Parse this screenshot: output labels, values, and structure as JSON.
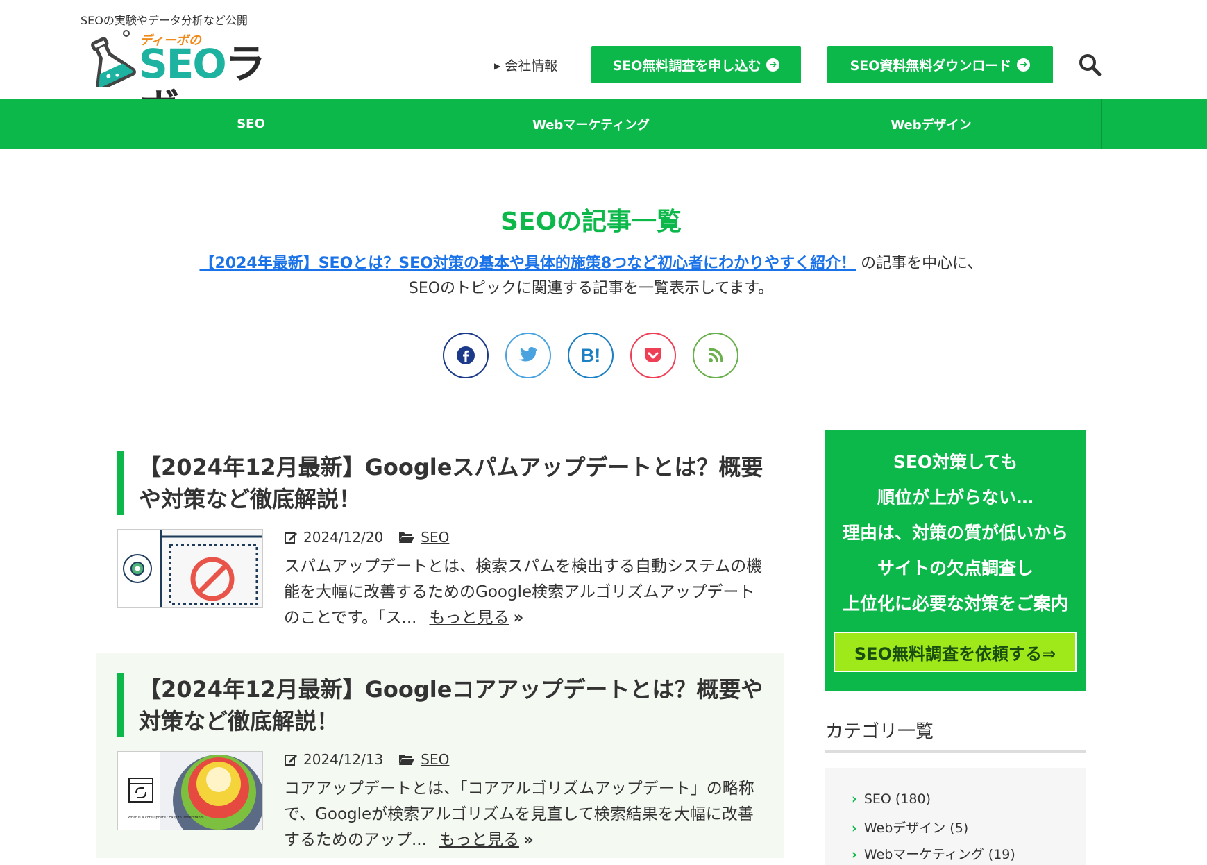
{
  "header": {
    "tagline": "SEOの実験やデータ分析など公開",
    "logo_sub": "ディーボの",
    "logo_seo": "SEO",
    "logo_labo": "ラボ",
    "company_link": "会社情報",
    "btn_survey": "SEO無料調査を申し込む",
    "btn_download": "SEO資料無料ダウンロード"
  },
  "nav": {
    "items": [
      "SEO",
      "Webマーケティング",
      "Webデザイン"
    ]
  },
  "main": {
    "page_title": "SEOの記事一覧",
    "intro_link": "【2024年最新】SEOとは？SEO対策の基本や具体的施策8つなど初心者にわかりやすく紹介！",
    "intro_after": "の記事を中心に、",
    "intro_line2": "SEOのトピックに関連する記事を一覧表示してます。"
  },
  "share": {
    "icons": [
      "facebook-icon",
      "twitter-icon",
      "hatena-bookmark-icon",
      "pocket-icon",
      "rss-icon"
    ],
    "colors": [
      "#1d3a8a",
      "#4aa3df",
      "#1b80c4",
      "#ef3f56",
      "#6ab04c"
    ]
  },
  "articles": [
    {
      "title": "【2024年12月最新】Googleスパムアップデートとは？概要や対策など徹底解説！",
      "date": "2024/12/20",
      "category": "SEO",
      "excerpt": "スパムアップデートとは、検索スパムを検出する自動システムの機能を大幅に改善するためのGoogle検索アルゴリズムアップデートのことです。「ス...",
      "more": "もっと見る"
    },
    {
      "title": "【2024年12月最新】Googleコアアップデートとは？概要や対策など徹底解説！",
      "date": "2024/12/13",
      "category": "SEO",
      "excerpt": "コアアップデートとは、「コアアルゴリズムアップデート」の略称で、Googleが検索アルゴリズムを見直して検索結果を大幅に改善するためのアップ...",
      "more": "もっと見る",
      "thumb_caption": "What is a core update? Easy to understand!"
    }
  ],
  "sidebar": {
    "banner_lines": [
      "SEO対策しても",
      "順位が上がらない…",
      "理由は、対策の質が低いから",
      "サイトの欠点調査し",
      "上位化に必要な対策をご案内"
    ],
    "banner_button": "SEO無料調査を依頼する⇒",
    "category_title": "カテゴリ一覧",
    "categories": [
      "SEO (180)",
      "Webデザイン (5)",
      "Webマーケティング (19)"
    ]
  },
  "colors": {
    "brand_green": "#0cb84a",
    "link_blue": "#1a73e8",
    "alt_bg": "#f4f9f2"
  }
}
